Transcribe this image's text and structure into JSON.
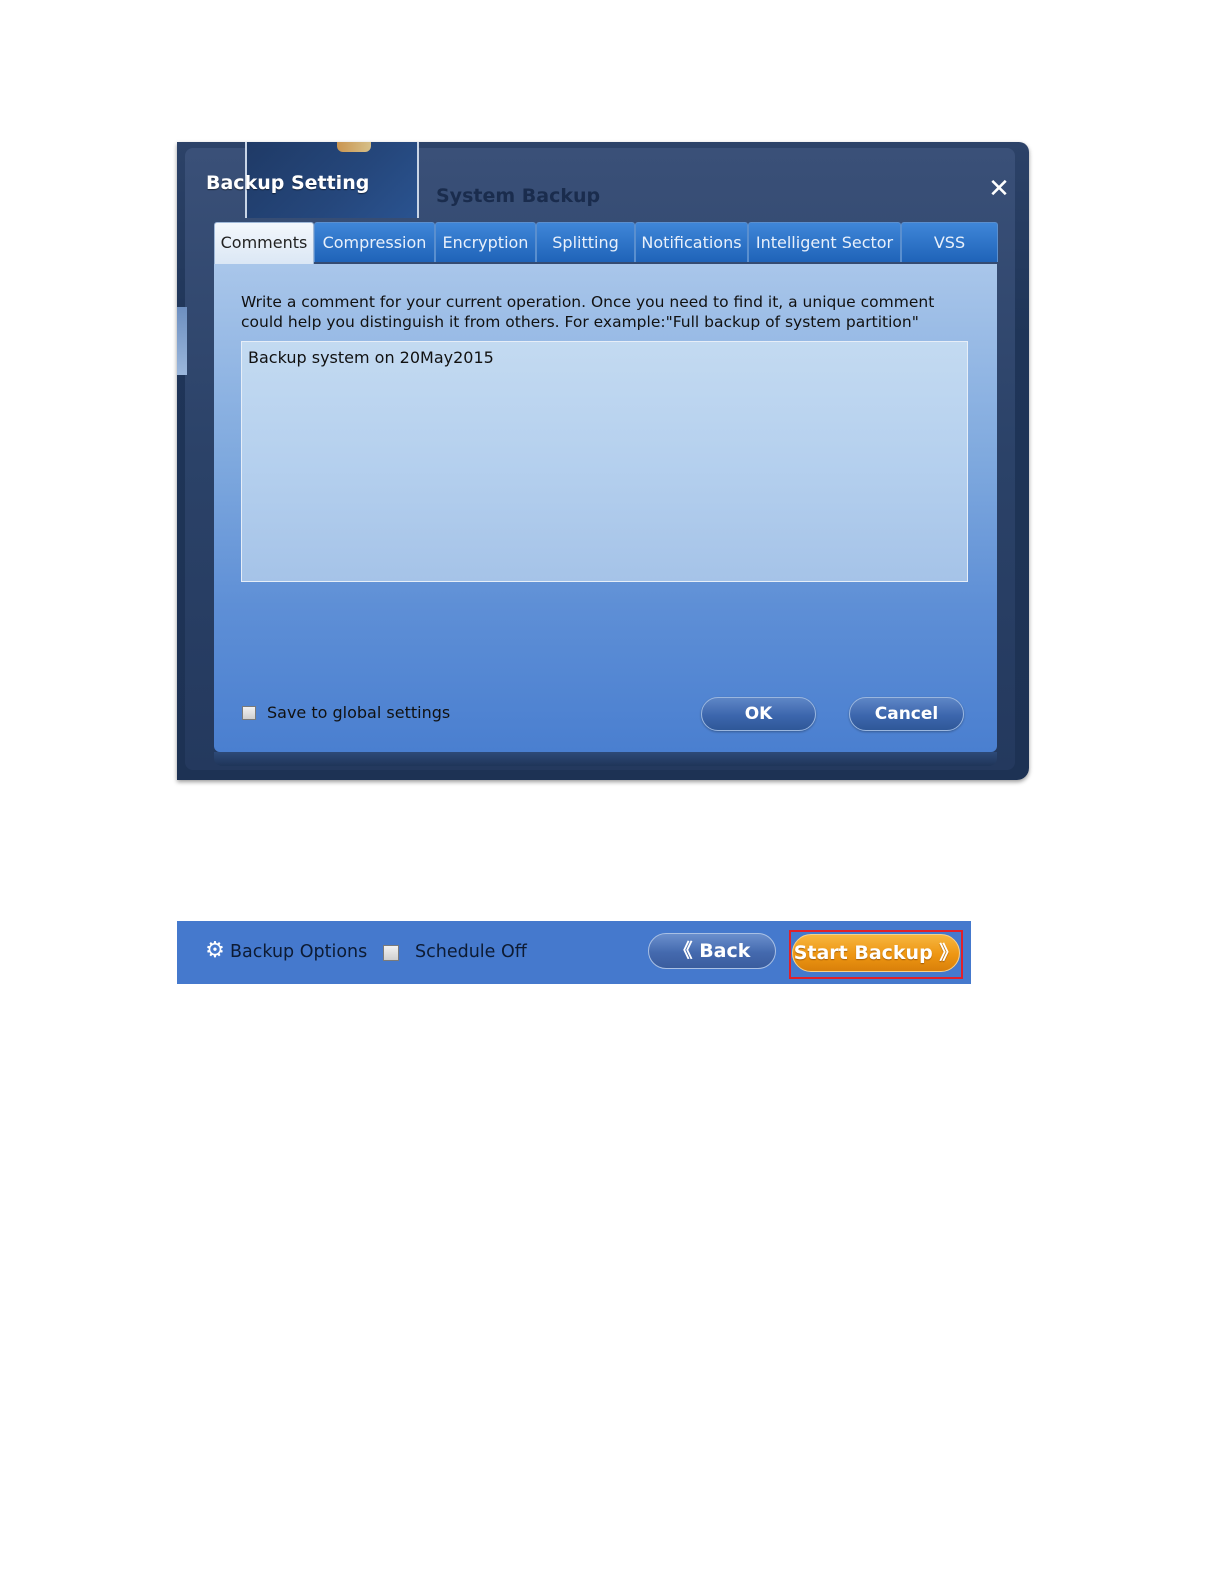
{
  "dialog": {
    "title": "Backup Setting",
    "background_title": "System Backup",
    "close_glyph": "✕",
    "tabs": [
      {
        "label": "Comments",
        "active": true
      },
      {
        "label": "Compression",
        "active": false
      },
      {
        "label": "Encryption",
        "active": false
      },
      {
        "label": "Splitting",
        "active": false
      },
      {
        "label": "Notifications",
        "active": false
      },
      {
        "label": "Intelligent Sector",
        "active": false
      },
      {
        "label": "VSS",
        "active": false
      }
    ],
    "description_line1": "Write a comment for your current operation. Once you need to find it, a unique comment",
    "description_line2": "could help you distinguish it from others. For example:\"Full backup of system partition\"",
    "comment_value": "Backup system on 20May2015",
    "save_global_label": "Save to global settings",
    "save_global_checked": false,
    "ok_label": "OK",
    "cancel_label": "Cancel"
  },
  "toolbar": {
    "options_icon": "gear-icon",
    "options_label": "Backup Options",
    "schedule_checked": false,
    "schedule_label": "Schedule Off",
    "back_label": "《 Back",
    "start_label": "Start Backup 》",
    "highlight_color": "#e0202a"
  }
}
